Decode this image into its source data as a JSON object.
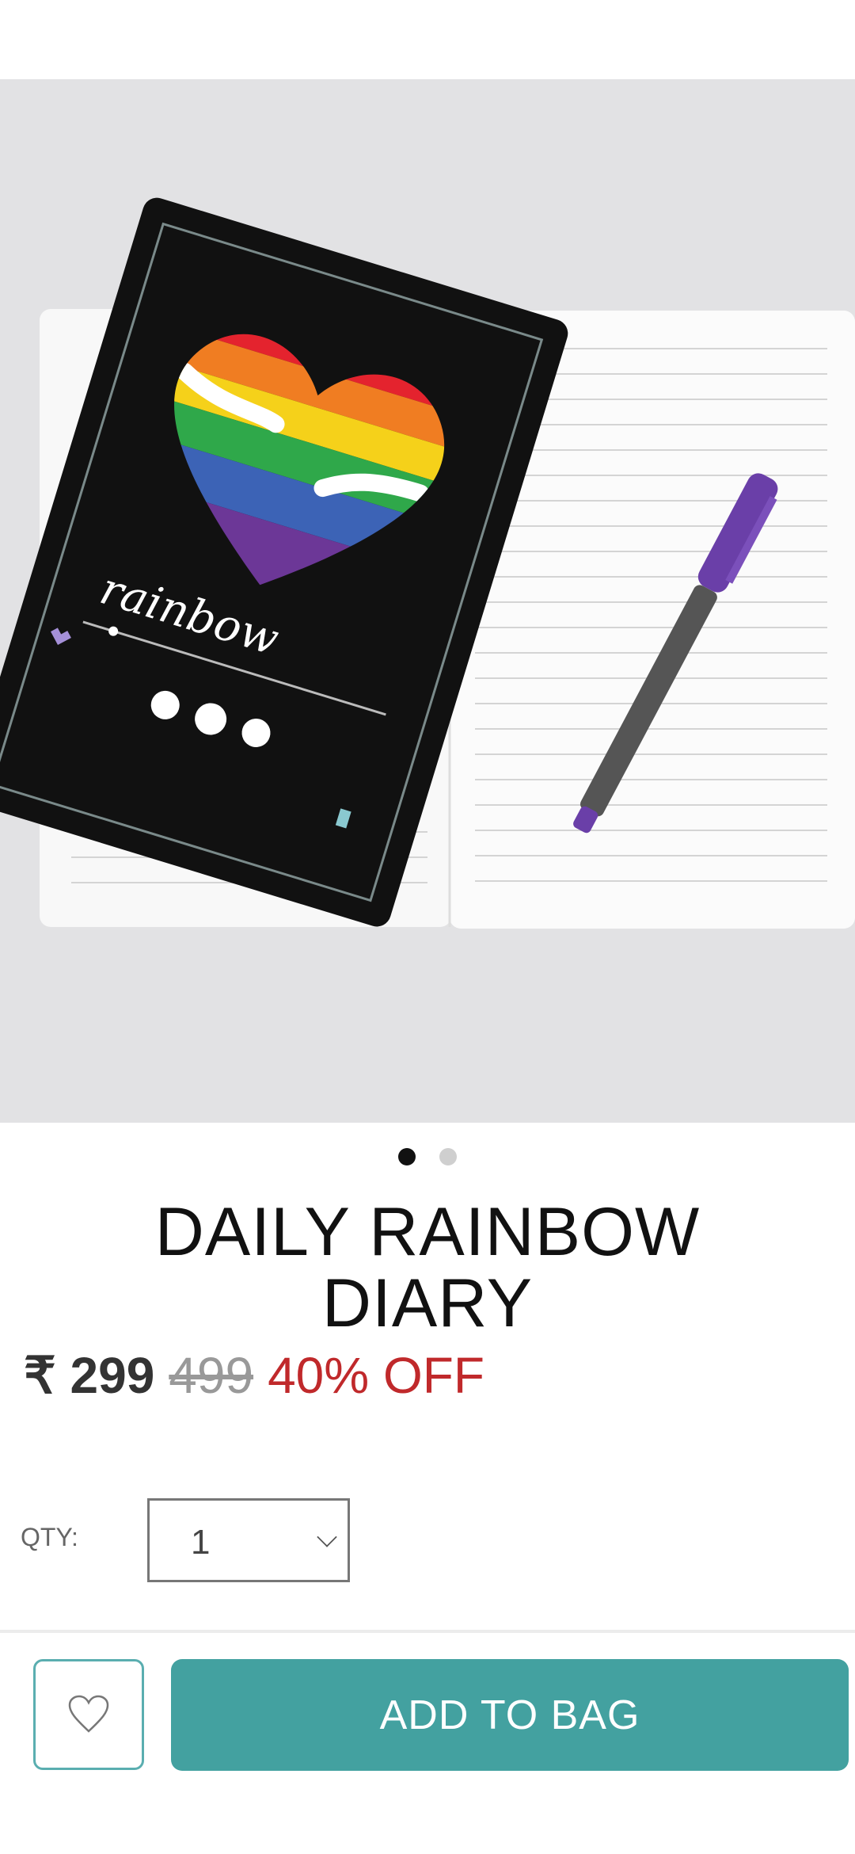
{
  "product_image": {
    "cover_text": "rainbow",
    "slide_count": 2,
    "active_slide": 1
  },
  "product": {
    "title": "DAILY RAINBOW DIARY",
    "price": "₹ 299",
    "mrp": "499",
    "discount": "40% OFF"
  },
  "quantity": {
    "label": "QTY:",
    "value": "1"
  },
  "actions": {
    "wishlist_icon": "heart-outline-icon",
    "add_to_bag": "ADD TO BAG"
  },
  "colors": {
    "accent": "#43a1a0",
    "discount": "#c0292b"
  }
}
